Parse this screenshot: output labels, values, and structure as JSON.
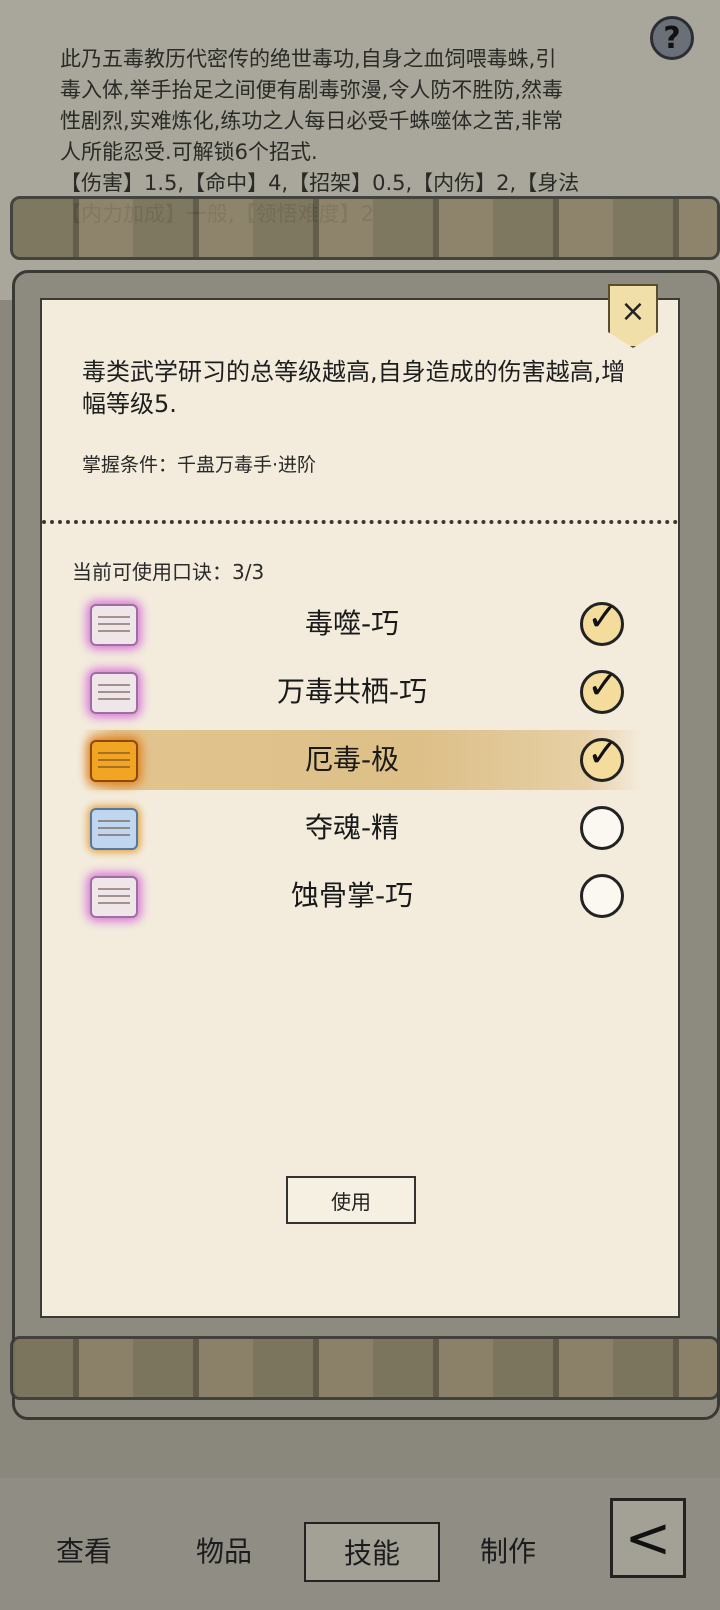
{
  "background": {
    "description_text": "此乃五毒教历代密传的绝世毒功,自身之血饲喂毒蛛,引\n毒入体,举手抬足之间便有剧毒弥漫,令人防不胜防,然毒\n性剧烈,实难炼化,练功之人每日必受千蛛噬体之苦,非常\n人所能忍受.可解锁6个招式.\n【伤害】1.5,【命中】4,【招架】0.5,【内伤】2,【身法\n【内力加成】一般,【领悟难度】2",
    "help_label": "?"
  },
  "dialog": {
    "close_label": "×",
    "description": "毒类武学研习的总等级越高,自身造成的伤害越高,增幅等级5.",
    "requirement": "掌握条件：千蛊万毒手·进阶",
    "count": "当前可使用口诀：3/3",
    "use_label": "使用",
    "skills": [
      {
        "name": "毒噬-巧",
        "checked": true,
        "icon": "scroll-icon-pink"
      },
      {
        "name": "万毒共栖-巧",
        "checked": true,
        "icon": "scroll-icon-pink"
      },
      {
        "name": "厄毒-极",
        "checked": true,
        "icon": "scroll-icon-gold"
      },
      {
        "name": "夺魂-精",
        "checked": false,
        "icon": "scroll-icon-blue"
      },
      {
        "name": "蚀骨掌-巧",
        "checked": false,
        "icon": "scroll-icon-pink"
      }
    ]
  },
  "nav": {
    "tabs": [
      "查看",
      "物品",
      "技能",
      "制作"
    ],
    "active": "技能",
    "back_label": "<"
  }
}
